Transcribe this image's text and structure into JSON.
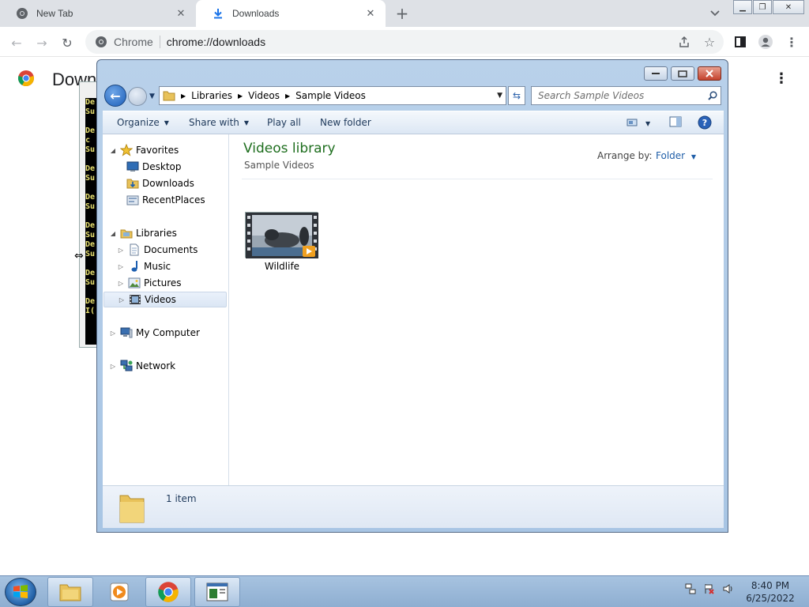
{
  "browser": {
    "tabs": [
      {
        "title": "New Tab",
        "active": false
      },
      {
        "title": "Downloads",
        "active": true
      }
    ],
    "omnibox": {
      "site_label": "Chrome",
      "url": "chrome://downloads"
    }
  },
  "downloads_page": {
    "title": "Down"
  },
  "console": {
    "lines": [
      "De",
      "Su",
      "",
      "De",
      "c",
      "Su",
      "",
      "De",
      "Su",
      "",
      "De",
      "Su",
      "",
      "De",
      "Su",
      "De",
      "Su",
      "",
      "De",
      "Su",
      "",
      "De",
      "I("
    ]
  },
  "explorer": {
    "breadcrumb": [
      "Libraries",
      "Videos",
      "Sample Videos"
    ],
    "search_placeholder": "Search Sample Videos",
    "commands": {
      "organize": "Organize",
      "share_with": "Share with",
      "play_all": "Play all",
      "new_folder": "New folder"
    },
    "nav": {
      "favorites": "Favorites",
      "desktop": "Desktop",
      "downloads": "Downloads",
      "recent_places": "RecentPlaces",
      "libraries": "Libraries",
      "documents": "Documents",
      "music": "Music",
      "pictures": "Pictures",
      "videos": "Videos",
      "my_computer": "My Computer",
      "network": "Network"
    },
    "content": {
      "library_title": "Videos library",
      "library_subtitle": "Sample Videos",
      "arrange_label": "Arrange by:",
      "arrange_value": "Folder",
      "items": [
        {
          "name": "Wildlife"
        }
      ]
    },
    "details": {
      "count": "1 item"
    }
  },
  "taskbar": {
    "time": "8:40 PM",
    "date": "6/25/2022"
  },
  "colors": {
    "library_title": "#1e6e1e",
    "link_blue": "#1f5ea8",
    "taskbar": "#a7c3e0"
  }
}
